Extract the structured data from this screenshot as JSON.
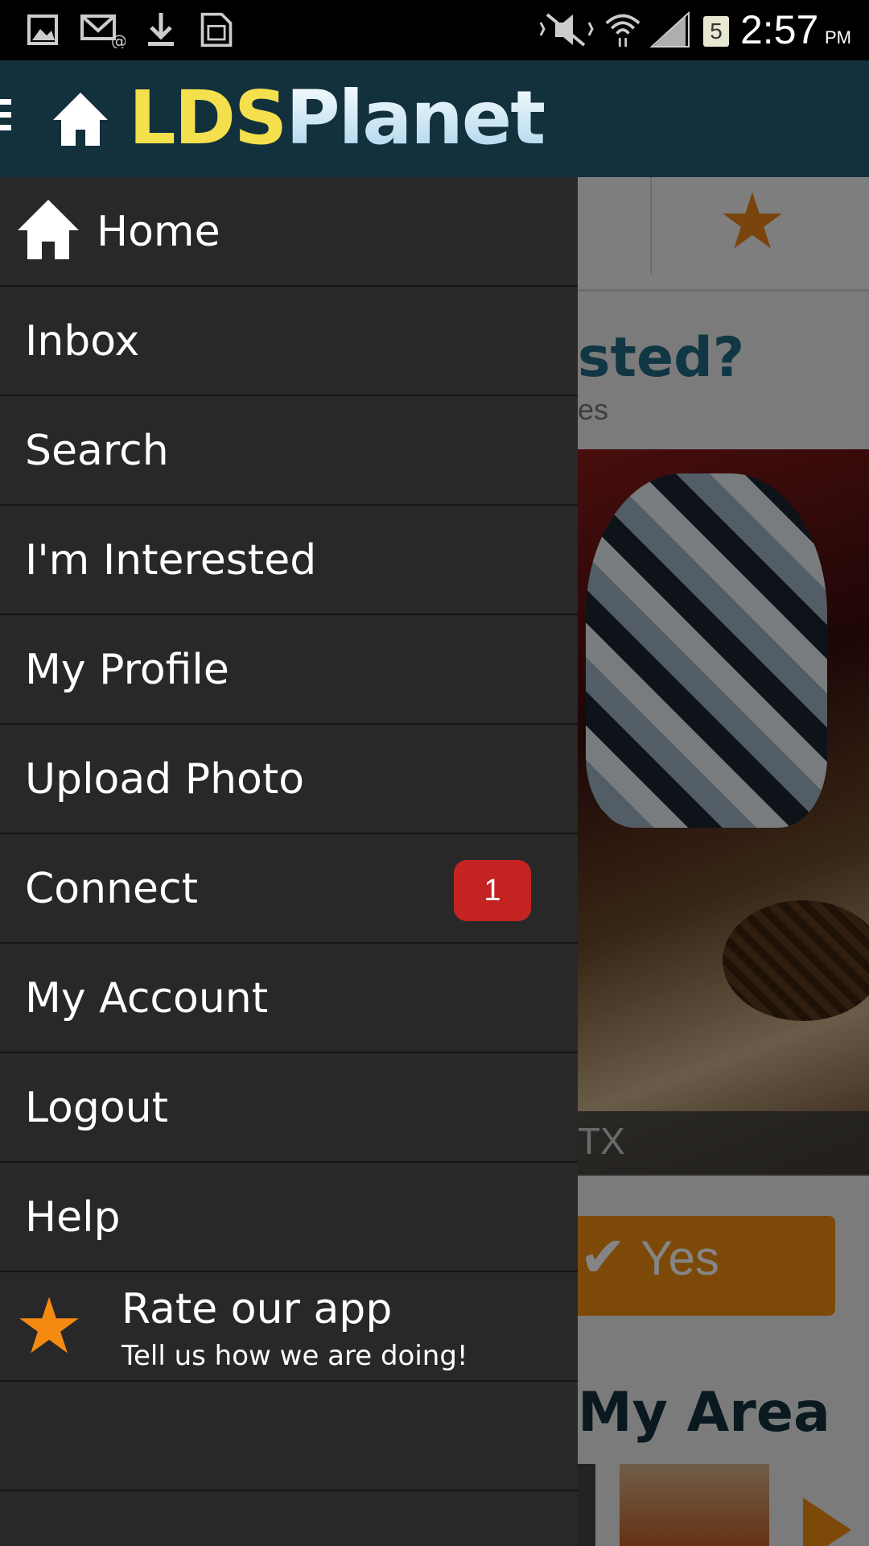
{
  "status_bar": {
    "time": "2:57",
    "ampm": "PM",
    "battery_level": "5",
    "icons": [
      "gallery-icon",
      "email-icon",
      "download-icon",
      "sim-icon",
      "mute-icon",
      "wifi-icon",
      "signal-icon",
      "battery-icon"
    ]
  },
  "header": {
    "logo_part1": "LDS",
    "logo_part2": "Planet",
    "colors": {
      "background": "#12313c",
      "logo_lds": "#f4e04d"
    }
  },
  "drawer": {
    "items": [
      {
        "label": "Home",
        "icon": "home-icon"
      },
      {
        "label": "Inbox"
      },
      {
        "label": "Search"
      },
      {
        "label": "I'm Interested"
      },
      {
        "label": "My Profile"
      },
      {
        "label": "Upload Photo"
      },
      {
        "label": "Connect",
        "badge": "1"
      },
      {
        "label": "My Account"
      },
      {
        "label": "Logout"
      },
      {
        "label": "Help"
      }
    ],
    "rate": {
      "title": "Rate our app",
      "subtitle": "Tell us how we are doing!",
      "icon": "star-icon"
    },
    "colors": {
      "background": "#282828",
      "badge": "#c42421",
      "star": "#f58a12"
    }
  },
  "background": {
    "heading_fragment": "sted?",
    "sub_fragment": "es",
    "caption_fragment": "TX",
    "yes_label": "Yes",
    "section_fragment": "My Area"
  }
}
